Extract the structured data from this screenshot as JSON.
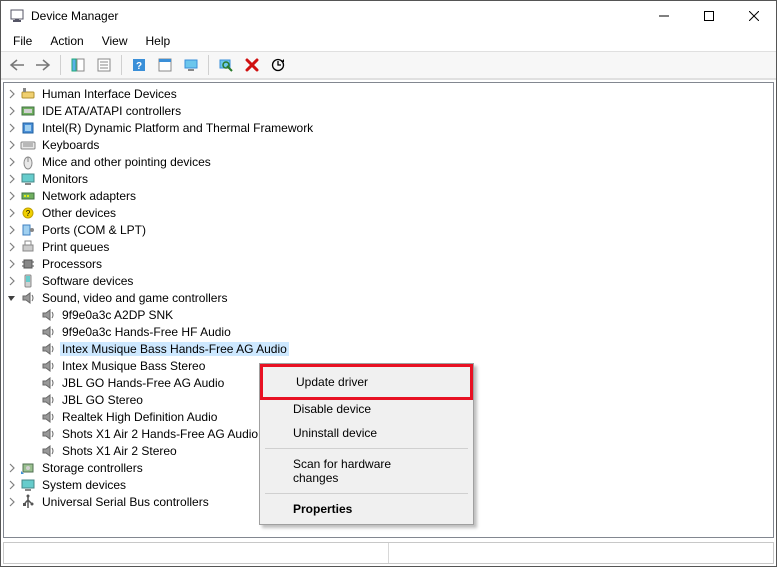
{
  "title": "Device Manager",
  "menu": {
    "file": "File",
    "action": "Action",
    "view": "View",
    "help": "Help"
  },
  "toolbar": [
    "back",
    "forward",
    "|",
    "show",
    "details",
    "|",
    "help",
    "monitors",
    "display",
    "|",
    "scan",
    "delete",
    "update"
  ],
  "categories": [
    {
      "icon": "hid",
      "label": "Human Interface Devices"
    },
    {
      "icon": "ide",
      "label": "IDE ATA/ATAPI controllers"
    },
    {
      "icon": "intel",
      "label": "Intel(R) Dynamic Platform and Thermal Framework"
    },
    {
      "icon": "keyboard",
      "label": "Keyboards"
    },
    {
      "icon": "mouse",
      "label": "Mice and other pointing devices"
    },
    {
      "icon": "monitor",
      "label": "Monitors"
    },
    {
      "icon": "network",
      "label": "Network adapters"
    },
    {
      "icon": "other",
      "label": "Other devices"
    },
    {
      "icon": "port",
      "label": "Ports (COM & LPT)"
    },
    {
      "icon": "printer",
      "label": "Print queues"
    },
    {
      "icon": "cpu",
      "label": "Processors"
    },
    {
      "icon": "software",
      "label": "Software devices"
    }
  ],
  "sound_label": "Sound, video and game controllers",
  "sound_devices": [
    "9f9e0a3c A2DP SNK",
    "9f9e0a3c Hands-Free HF Audio",
    "Intex Musique Bass Hands-Free AG Audio",
    "Intex Musique Bass Stereo",
    "JBL GO Hands-Free AG Audio",
    "JBL GO Stereo",
    "Realtek High Definition Audio",
    "Shots X1 Air 2 Hands-Free AG Audio",
    "Shots X1 Air 2 Stereo"
  ],
  "selected_index": 2,
  "after_categories": [
    {
      "icon": "storage",
      "label": "Storage controllers"
    },
    {
      "icon": "system",
      "label": "System devices"
    },
    {
      "icon": "usb",
      "label": "Universal Serial Bus controllers"
    }
  ],
  "ctx": {
    "update": "Update driver",
    "disable": "Disable device",
    "uninstall": "Uninstall device",
    "scan": "Scan for hardware changes",
    "properties": "Properties"
  }
}
